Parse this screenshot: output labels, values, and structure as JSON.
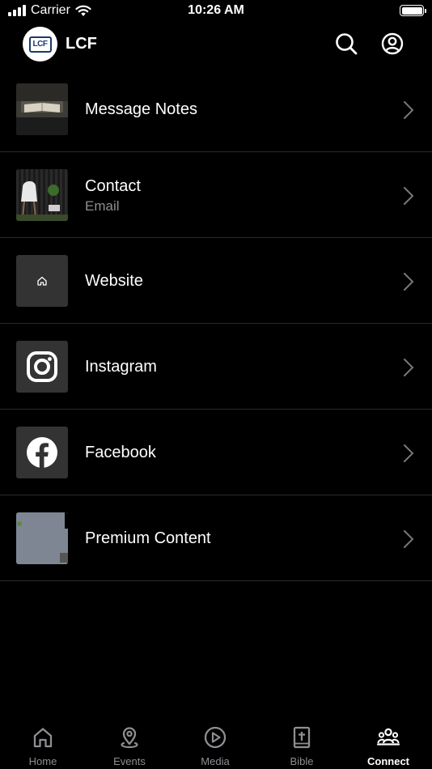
{
  "status_bar": {
    "carrier": "Carrier",
    "time": "10:26 AM"
  },
  "header": {
    "logo_text": "LCF",
    "title": "LCF"
  },
  "list": [
    {
      "title": "Message Notes",
      "subtitle": ""
    },
    {
      "title": "Contact",
      "subtitle": "Email"
    },
    {
      "title": "Website",
      "subtitle": ""
    },
    {
      "title": "Instagram",
      "subtitle": ""
    },
    {
      "title": "Facebook",
      "subtitle": ""
    },
    {
      "title": "Premium Content",
      "subtitle": ""
    }
  ],
  "tabs": [
    {
      "label": "Home",
      "icon": "home-icon",
      "active": false
    },
    {
      "label": "Events",
      "icon": "location-pin-icon",
      "active": false
    },
    {
      "label": "Media",
      "icon": "play-circle-icon",
      "active": false
    },
    {
      "label": "Bible",
      "icon": "bible-icon",
      "active": false
    },
    {
      "label": "Connect",
      "icon": "people-icon",
      "active": true
    }
  ],
  "colors": {
    "background": "#000000",
    "text": "#ffffff",
    "secondary_text": "#8e8e93",
    "divider": "#2a2a2a"
  }
}
